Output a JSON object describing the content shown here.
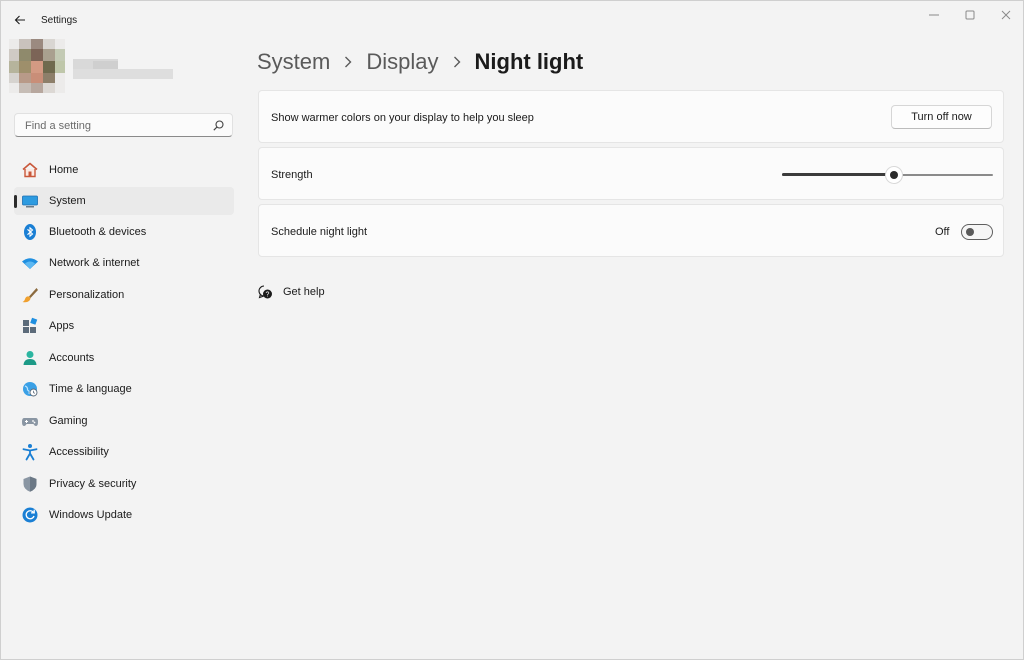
{
  "window": {
    "title": "Settings"
  },
  "search": {
    "placeholder": "Find a setting"
  },
  "sidebar": {
    "items": [
      {
        "label": "Home",
        "icon": "home-icon",
        "active": false
      },
      {
        "label": "System",
        "icon": "monitor-icon",
        "active": true
      },
      {
        "label": "Bluetooth & devices",
        "icon": "bluetooth-icon",
        "active": false
      },
      {
        "label": "Network & internet",
        "icon": "wifi-icon",
        "active": false
      },
      {
        "label": "Personalization",
        "icon": "brush-icon",
        "active": false
      },
      {
        "label": "Apps",
        "icon": "apps-icon",
        "active": false
      },
      {
        "label": "Accounts",
        "icon": "person-icon",
        "active": false
      },
      {
        "label": "Time & language",
        "icon": "globe-clock-icon",
        "active": false
      },
      {
        "label": "Gaming",
        "icon": "gamepad-icon",
        "active": false
      },
      {
        "label": "Accessibility",
        "icon": "accessibility-icon",
        "active": false
      },
      {
        "label": "Privacy & security",
        "icon": "shield-icon",
        "active": false
      },
      {
        "label": "Windows Update",
        "icon": "update-icon",
        "active": false
      }
    ]
  },
  "breadcrumb": {
    "items": [
      "System",
      "Display"
    ],
    "current": "Night light"
  },
  "night_light": {
    "description": "Show warmer colors on your display to help you sleep",
    "button_label": "Turn off now"
  },
  "strength": {
    "label": "Strength",
    "value_fraction": 0.53
  },
  "schedule": {
    "label": "Schedule night light",
    "state_label": "Off",
    "on": false
  },
  "help": {
    "label": "Get help"
  },
  "colors": {
    "accent": "#0067c0",
    "background": "#f3f3f3",
    "card": "#fbfbfb"
  }
}
